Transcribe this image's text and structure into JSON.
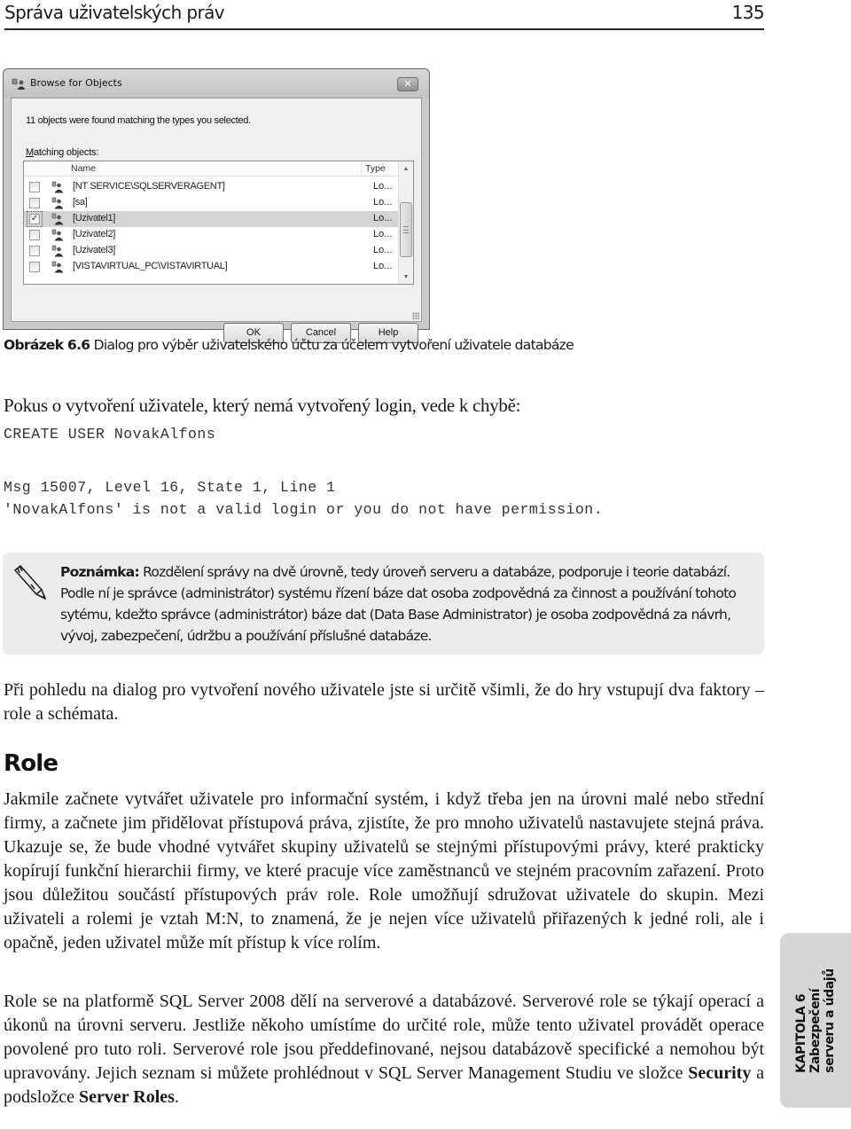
{
  "running_header": {
    "title": "Správa uživatelských práv",
    "page_number": "135"
  },
  "dialog": {
    "title": "Browse for Objects",
    "close_label": "✕",
    "message": "11 objects were found matching the types you selected.",
    "list_label_accel": "M",
    "list_label_rest": "atching objects:",
    "columns": {
      "name": "Name",
      "type": "Type"
    },
    "rows": [
      {
        "name": "[NT SERVICE\\SQLSERVERAGENT]",
        "type": "Lo...",
        "checked": false,
        "selected": false,
        "icon": "login-icon"
      },
      {
        "name": "[sa]",
        "type": "Lo...",
        "checked": false,
        "selected": false,
        "icon": "login-icon"
      },
      {
        "name": "[Uzivatel1]",
        "type": "Lo...",
        "checked": true,
        "selected": true,
        "icon": "login-icon"
      },
      {
        "name": "[Uzivatel2]",
        "type": "Lo...",
        "checked": false,
        "selected": false,
        "icon": "login-icon"
      },
      {
        "name": "[Uzivatel3]",
        "type": "Lo...",
        "checked": false,
        "selected": false,
        "icon": "login-icon"
      },
      {
        "name": "[VISTAVIRTUAL_PC\\VISTAVIRTUAL]",
        "type": "Lo...",
        "checked": false,
        "selected": false,
        "icon": "login-icon"
      }
    ],
    "buttons": {
      "ok": "OK",
      "cancel": "Cancel",
      "help": "Help"
    }
  },
  "caption": {
    "label": "Obrázek 6.6",
    "text": " Dialog pro výběr uživatelského účtu za účelem vytvoření uživatele databáze"
  },
  "intro_text": "Pokus o vytvoření uživatele, který nemá vytvořený login, vede k chybě:",
  "code": {
    "statement": "CREATE USER NovakAlfons",
    "error_line1": "Msg 15007, Level 16, State 1, Line 1",
    "error_line2": "'NovakAlfons' is not a valid login or you do not have permission."
  },
  "note": {
    "label": "Poznámka:",
    "text": " Rozdělení správy na dvě úrovně, tedy úroveň serveru a databáze, podporuje i teorie databází. Podle ní je správce (administrátor) systému řízení báze dat osoba zodpovědná za činnost a používání tohoto sytému, kdežto správce (administrátor) báze dat (Data Base Administrator) je osoba zodpovědná za návrh, vývoj, zabezpečení, údržbu a používání příslušné databáze."
  },
  "paragraph1": "Při pohledu na dialog pro vytvoření nového uživatele jste si určitě všimli, že do hry vstupují dva faktory – role a schémata.",
  "section_heading": "Role",
  "paragraph2": "Jakmile začnete vytvářet uživatele pro informační systém, i když třeba jen na úrovni malé nebo střední firmy, a začnete jim přidělovat přístupová práva, zjistíte, že pro mnoho uživatelů nastavujete stejná práva. Ukazuje se, že bude vhodné vytvářet skupiny uživatelů se stejnými přístupovými právy, které prakticky kopírují funkční hierarchii firmy, ve které pracuje více zaměstnanců ve stejném pracovním zařazení. Proto jsou důležitou součástí přístupových práv role. Role umožňují sdružovat uživatele do skupin. Mezi uživateli a rolemi je vztah M:N, to znamená, že je nejen více uživatelů přiřazených k jedné roli, ale i opačně, jeden uživatel může mít přístup k více rolím.",
  "paragraph3": {
    "text_before": "Role se na platformě SQL Server 2008 dělí na serverové a databázové. Serverové role se týkají operací a úkonů na úrovni serveru. Jestliže někoho umístíme do určité role, může tento uživatel provádět operace povolené pro tuto roli. Serverové role jsou předdefinované, nejsou databázově specifické a nemohou být upravovány. Jejich seznam si můžete prohlédnout v SQL Server Management Studiu ve složce ",
    "bold1": "Security",
    "text_middle": " a podsložce ",
    "bold2": "Server Roles",
    "text_after": "."
  },
  "chapter_tab": {
    "line1": "KAPITOLA 6",
    "line2": "Zabezpečení",
    "line3": "serveru a údajů"
  }
}
